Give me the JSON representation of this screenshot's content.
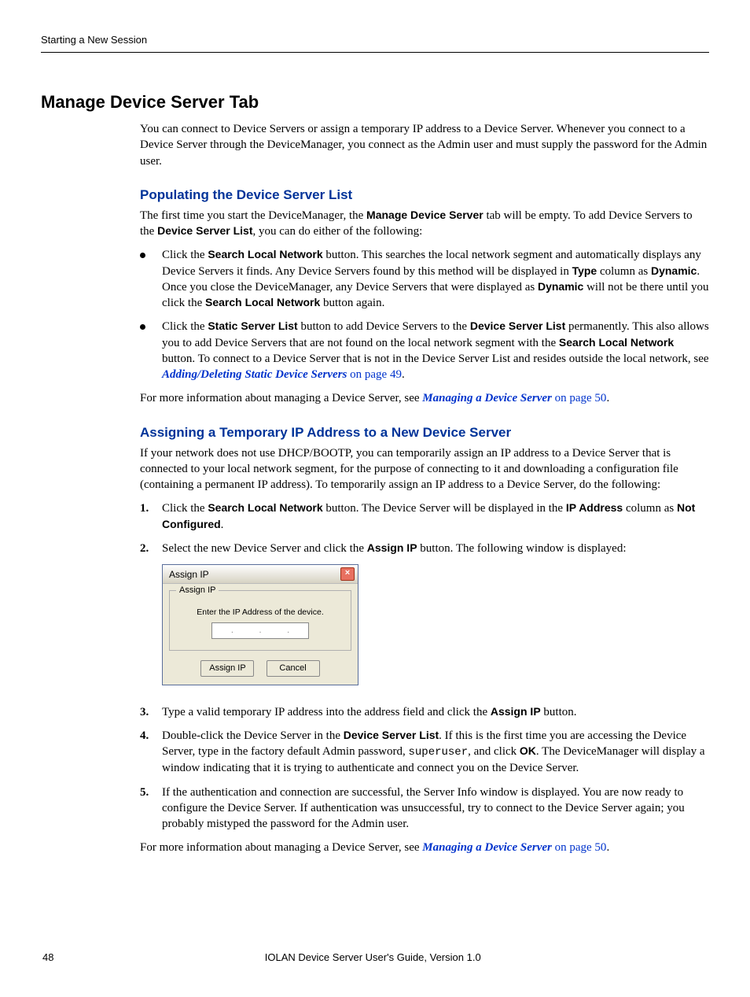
{
  "header": {
    "breadcrumb": "Starting a New Session"
  },
  "h1": "Manage Device Server Tab",
  "intro": "You can connect to Device Servers or assign a temporary IP address to a Device Server. Whenever you connect to a Device Server through the DeviceManager, you connect as the Admin user and must supply the password for the Admin user.",
  "section1": {
    "heading": "Populating the Device Server List",
    "intro_pre": "The first time you start the DeviceManager, the ",
    "intro_b1": "Manage Device Server",
    "intro_mid1": " tab will be empty. To add Device Servers to the ",
    "intro_b2": "Device Server List",
    "intro_tail": ", you can do either of the following:",
    "bullet1": {
      "t1": "Click the ",
      "b1": "Search Local Network",
      "t2": " button. This searches the local network segment and automatically displays any Device Servers it finds. Any Device Servers found by this method will be displayed in ",
      "b2": "Type",
      "t3": " column as ",
      "b3": "Dynamic",
      "t4": ". Once you close the DeviceManager, any Device Servers that were displayed as ",
      "b4": "Dynamic",
      "t5": " will not be there until you click the ",
      "b5": "Search Local Network",
      "t6": " button again."
    },
    "bullet2": {
      "t1": "Click the ",
      "b1": "Static Server List",
      "t2": " button to add Device Servers to the ",
      "b2": "Device Server List",
      "t3": " permanently. This also allows you to add Device Servers that are not found on the local network segment with the ",
      "b3": "Search Local Network",
      "t4": " button. To connect to a Device Server that is not in the Device Server List and resides outside the local network, see ",
      "link": "Adding/Deleting Static Device Servers",
      "link_tail": " on page 49",
      "t5": "."
    },
    "outro_pre": "For more information about managing a Device Server, see ",
    "outro_link": "Managing a Device Server",
    "outro_link_tail": " on page 50",
    "outro_tail": "."
  },
  "section2": {
    "heading": "Assigning a Temporary IP Address to a New Device Server",
    "intro": "If your network does not use DHCP/BOOTP, you can temporarily assign an IP address to a Device Server that is connected to your local network segment, for the purpose of connecting to it and downloading a configuration file (containing a permanent IP address). To temporarily assign an IP address to a Device Server, do the following:",
    "step1": {
      "t1": "Click the ",
      "b1": "Search Local Network",
      "t2": " button. The Device Server will be displayed in the ",
      "b2": "IP Address",
      "t3": " column as ",
      "b3": "Not Configured",
      "t4": "."
    },
    "step2": {
      "t1": "Select the new Device Server and click the ",
      "b1": "Assign IP",
      "t2": " button. The following window is displayed:"
    },
    "step3": {
      "t1": "Type a valid temporary IP address into the address field and click the ",
      "b1": "Assign IP",
      "t2": " button."
    },
    "step4": {
      "t1": "Double-click the Device Server in the ",
      "b1": "Device Server List",
      "t2": ". If this is the first time you are accessing the Device Server, type in the factory default Admin password, ",
      "m1": "superuser",
      "t3": ", and click ",
      "b2": "OK",
      "t4": ". The DeviceManager will display a window indicating that it is trying to authenticate and connect you on the Device Server."
    },
    "step5": "If the authentication and connection are successful, the Server Info window is displayed. You are now ready to configure the Device Server. If authentication was unsuccessful, try to connect to the Device Server again; you probably mistyped the password for the Admin user.",
    "outro_pre": "For more information about managing a Device Server, see ",
    "outro_link": "Managing a Device Server",
    "outro_link_tail": " on page 50",
    "outro_tail": "."
  },
  "dialog": {
    "title": "Assign IP",
    "legend": "Assign IP",
    "prompt": "Enter the IP Address of the device.",
    "btn_assign": "Assign IP",
    "btn_cancel": "Cancel"
  },
  "footer": {
    "page": "48",
    "text": "IOLAN Device Server User's Guide, Version 1.0"
  }
}
